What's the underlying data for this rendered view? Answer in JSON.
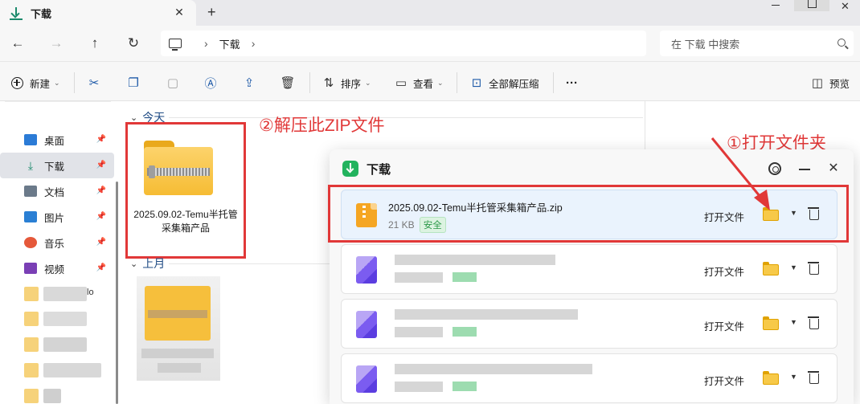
{
  "tab": {
    "title": "下载",
    "close": "✕",
    "add": "+"
  },
  "window": {
    "close": "✕"
  },
  "nav": {
    "back": "←",
    "forward": "→",
    "up": "↑",
    "refresh": "↻",
    "breadcrumb": [
      "下载"
    ],
    "chevron": "›",
    "search_placeholder": "在 下载 中搜索"
  },
  "toolbar": {
    "new_label": "新建",
    "sort_label": "排序",
    "view_label": "查看",
    "extract_all_label": "全部解压缩",
    "more_label": "···",
    "preview_label": "预览",
    "icons": [
      "cut-icon",
      "copy-icon",
      "paste-icon",
      "rename-icon",
      "share-icon",
      "delete-icon"
    ]
  },
  "sidebar": {
    "items": [
      {
        "label": "桌面",
        "icon": "desktop-icon",
        "color": "#2b7bd6"
      },
      {
        "label": "下载",
        "icon": "download-icon",
        "color": "#1c8a6c"
      },
      {
        "label": "文档",
        "icon": "documents-icon",
        "color": "#6b7a8a"
      },
      {
        "label": "图片",
        "icon": "pictures-icon",
        "color": "#2a7fd4"
      },
      {
        "label": "音乐",
        "icon": "music-icon",
        "color": "#e5583a"
      },
      {
        "label": "视频",
        "icon": "videos-icon",
        "color": "#7a3fb5"
      }
    ],
    "pin": "📌",
    "partial_text": "lo"
  },
  "main": {
    "group_today": "今天",
    "group_last_month": "上月",
    "file_name": "2025.09.02-Temu半托管采集箱产品"
  },
  "annotations": {
    "extract": "②解压此ZIP文件",
    "open_folder": "①打开文件夹"
  },
  "downloads_popup": {
    "title": "下载",
    "minimize": "—",
    "close": "✕",
    "items": [
      {
        "name": "2025.09.02-Temu半托管采集箱产品.zip",
        "size": "21 KB",
        "status": "安全",
        "action": "打开文件"
      },
      {
        "name": "",
        "size": "",
        "status": "",
        "action": "打开文件"
      },
      {
        "name": "",
        "size": "",
        "status": "",
        "action": "打开文件"
      },
      {
        "name": "",
        "size": "",
        "status": "",
        "action": "打开文件"
      }
    ]
  }
}
